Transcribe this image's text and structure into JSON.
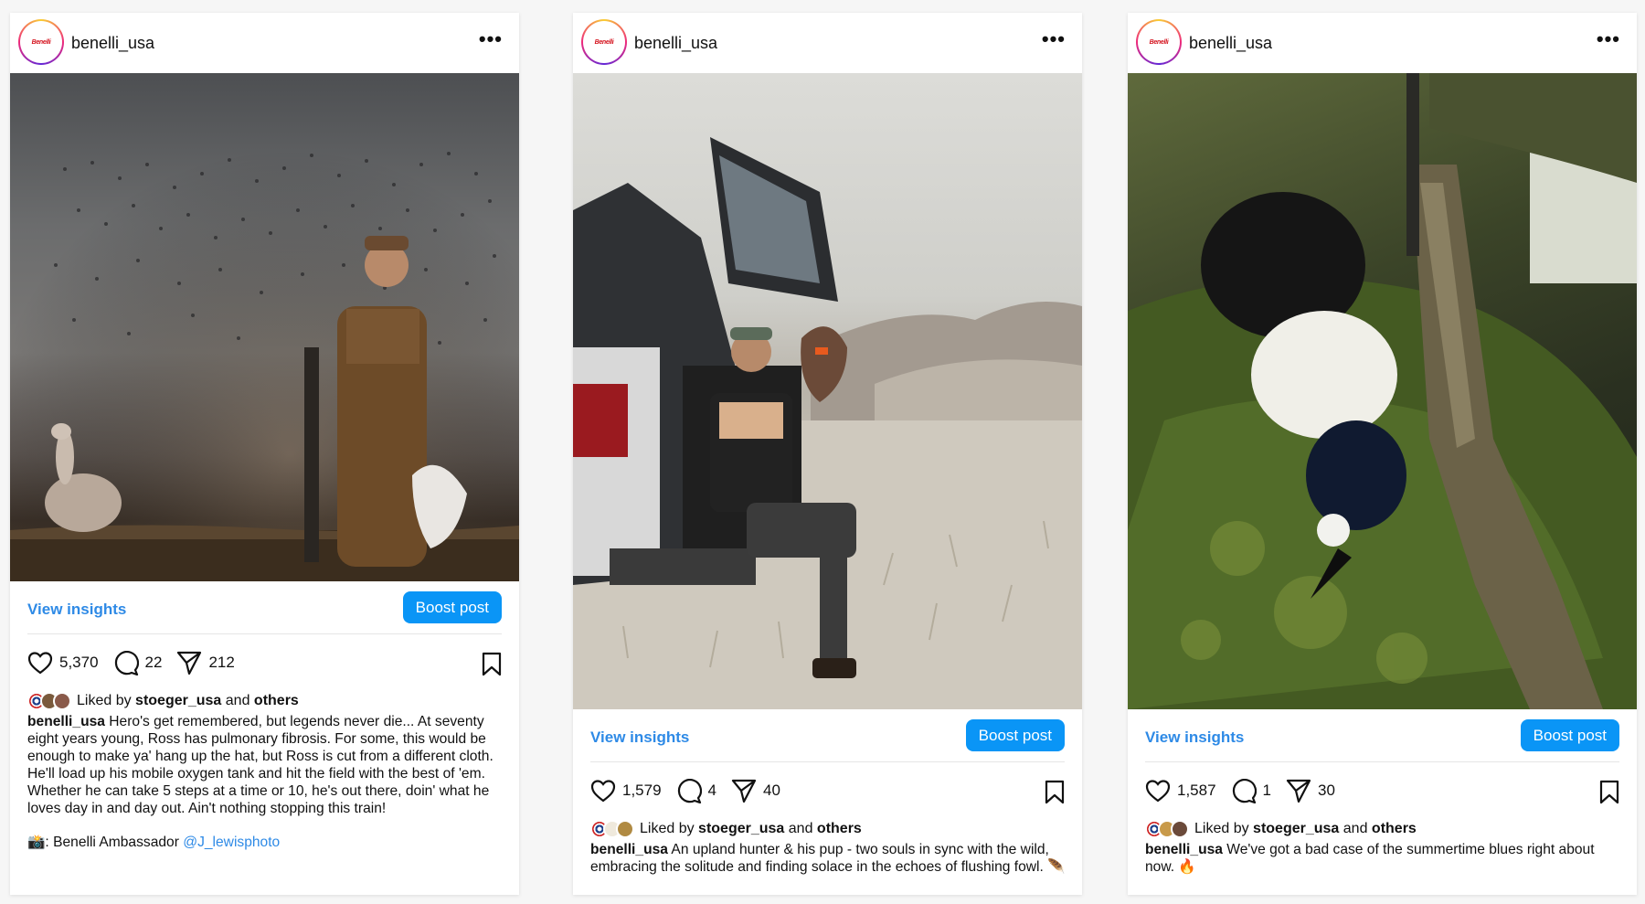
{
  "posts": [
    {
      "username": "benelli_usa",
      "avatar_logo": "Benelli",
      "insights_label": "View insights",
      "boost_label": "Boost post",
      "likes": "5,370",
      "comments": "22",
      "shares": "212",
      "liked_by_prefix": "Liked by",
      "liked_by_user": "stoeger_usa",
      "liked_by_and": "and",
      "liked_by_others": "others",
      "caption": "Hero's get remembered, but legends never die... At seventy eight years young, Ross has pulmonary fibrosis. For some, this would be enough to make ya' hang up the hat, but Ross is cut from a different cloth. He'll load up his mobile oxygen tank and hit the field with the best of 'em. Whether he can take 5 steps at a time or 10, he's out there, doin' what he loves day in and day out. Ain't nothing stopping this train!",
      "credit_icon": "📸",
      "credit_text": ": Benelli Ambassador ",
      "credit_link": "@J_lewisphoto"
    },
    {
      "username": "benelli_usa",
      "avatar_logo": "Benelli",
      "insights_label": "View insights",
      "boost_label": "Boost post",
      "likes": "1,579",
      "comments": "4",
      "shares": "40",
      "liked_by_prefix": "Liked by",
      "liked_by_user": "stoeger_usa",
      "liked_by_and": "and",
      "liked_by_others": "others",
      "caption": "An upland hunter & his pup - two souls in sync with the wild, embracing the solitude and finding solace in the echoes of flushing fowl. 🪶"
    },
    {
      "username": "benelli_usa",
      "avatar_logo": "Benelli",
      "insights_label": "View insights",
      "boost_label": "Boost post",
      "likes": "1,587",
      "comments": "1",
      "shares": "30",
      "liked_by_prefix": "Liked by",
      "liked_by_user": "stoeger_usa",
      "liked_by_and": "and",
      "liked_by_others": "others",
      "caption": "We've got a bad case of the summertime blues right about now. 🔥"
    }
  ],
  "colors": {
    "link": "#2e8ae6",
    "boost_button": "#0a95f6",
    "brand_red": "#d4111c"
  },
  "icons": [
    "more-icon",
    "heart-icon",
    "comment-icon",
    "share-icon",
    "bookmark-icon"
  ]
}
